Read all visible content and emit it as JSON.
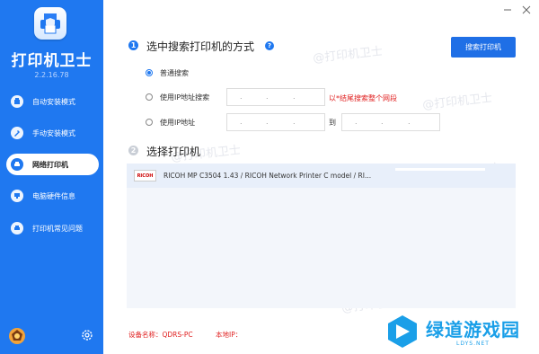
{
  "app": {
    "name": "打印机卫士",
    "version": "2.2.16.78"
  },
  "sidebar": {
    "items": [
      {
        "label": "自动安装模式",
        "icon": "auto-install-icon"
      },
      {
        "label": "手动安装模式",
        "icon": "manual-install-icon"
      },
      {
        "label": "网络打印机",
        "icon": "network-printer-icon",
        "active": true
      },
      {
        "label": "电脑硬件信息",
        "icon": "hardware-info-icon"
      },
      {
        "label": "打印机常见问题",
        "icon": "printer-faq-icon"
      }
    ]
  },
  "section1": {
    "number": "1",
    "title": "选中搜索打印机的方式",
    "help": "?",
    "search_button": "搜索打印机",
    "options": [
      {
        "label": "普通搜索",
        "selected": true
      },
      {
        "label": "使用IP地址搜索",
        "selected": false
      },
      {
        "label": "使用IP地址",
        "selected": false
      }
    ],
    "ip_tip": "以*结尾搜索整个网段",
    "range_to": "到",
    "ip_dot": "."
  },
  "section2": {
    "number": "2",
    "title": "选择打印机",
    "printers": [
      {
        "logo": "RICOH",
        "name": "RICOH MP C3504 1.43 / RICOH Network Printer C model / RI..."
      }
    ]
  },
  "footer": {
    "device_name": "设备名称：QDRS-PC",
    "local_ip": "本地IP："
  },
  "watermark": "@打印机卫士",
  "brand": {
    "text": "绿道游戏园",
    "sub": "LDYS.NET"
  },
  "colors": {
    "sidebar": "#1f78f0",
    "accent": "#1f6fe6",
    "tip": "#e02020",
    "brand": "#1a9fe8"
  }
}
